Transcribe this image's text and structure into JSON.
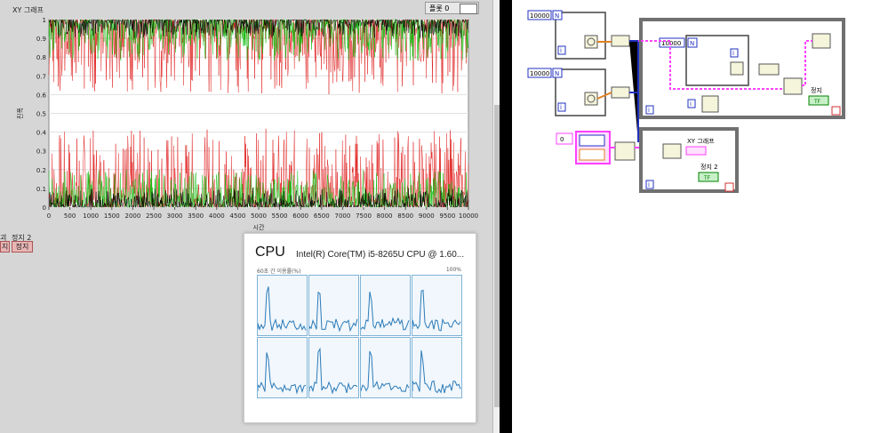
{
  "window": {
    "graph_title": "XY 그래프",
    "plot_legend": "플롯 0",
    "stop_labels": [
      "괴",
      "정지 2"
    ],
    "stop_buttons": [
      "지",
      "정지"
    ]
  },
  "chart_data": {
    "type": "line",
    "xlabel": "시간",
    "ylabel": "진폭",
    "xlim": [
      0,
      10000
    ],
    "ylim": [
      0,
      1
    ],
    "x_ticks": [
      0,
      500,
      1000,
      1500,
      2000,
      2500,
      3000,
      3500,
      4000,
      4500,
      5000,
      5500,
      6000,
      6500,
      7000,
      7500,
      8000,
      8500,
      9000,
      9500,
      10000
    ],
    "y_ticks": [
      0,
      0.1,
      0.2,
      0.3,
      0.4,
      0.5,
      0.6,
      0.7,
      0.8,
      0.9,
      1
    ],
    "series": [
      {
        "color": "#e0201f",
        "bands": [
          [
            0.0,
            0.42
          ],
          [
            0.6,
            1.0
          ]
        ]
      },
      {
        "color": "#10c010",
        "bands": [
          [
            0.0,
            0.2
          ],
          [
            0.78,
            1.0
          ]
        ]
      },
      {
        "color": "#000000",
        "bands": [
          [
            0.0,
            0.1
          ],
          [
            0.9,
            1.0
          ]
        ]
      }
    ]
  },
  "task_manager": {
    "title": "CPU",
    "cpu_name": "Intel(R) Core(TM) i5-8265U CPU @ 1.60...",
    "subtitle": "60초 간 이용률(%)",
    "max_label": "100%",
    "core_count": 8
  },
  "block_diagram": {
    "loop_counts": [
      "10000",
      "10000",
      "10000"
    ],
    "n_labels": [
      "N",
      "N",
      "N"
    ],
    "index_labels": [
      "i",
      "i",
      "i",
      "i",
      "i",
      "i"
    ],
    "const_zero": "0",
    "xy_graph_label": "XY 그래프",
    "stop_label": "정지",
    "stop2_label": "정지 2",
    "tf_label": "TF"
  },
  "colors": {
    "background": "#d6d6d6",
    "plot_bg": "#ffffff",
    "wire_pink": "#ff40ff",
    "wire_blue": "#2030c0",
    "wire_orange": "#e08020",
    "wire_green": "#008000",
    "loop_border": "#707070"
  }
}
